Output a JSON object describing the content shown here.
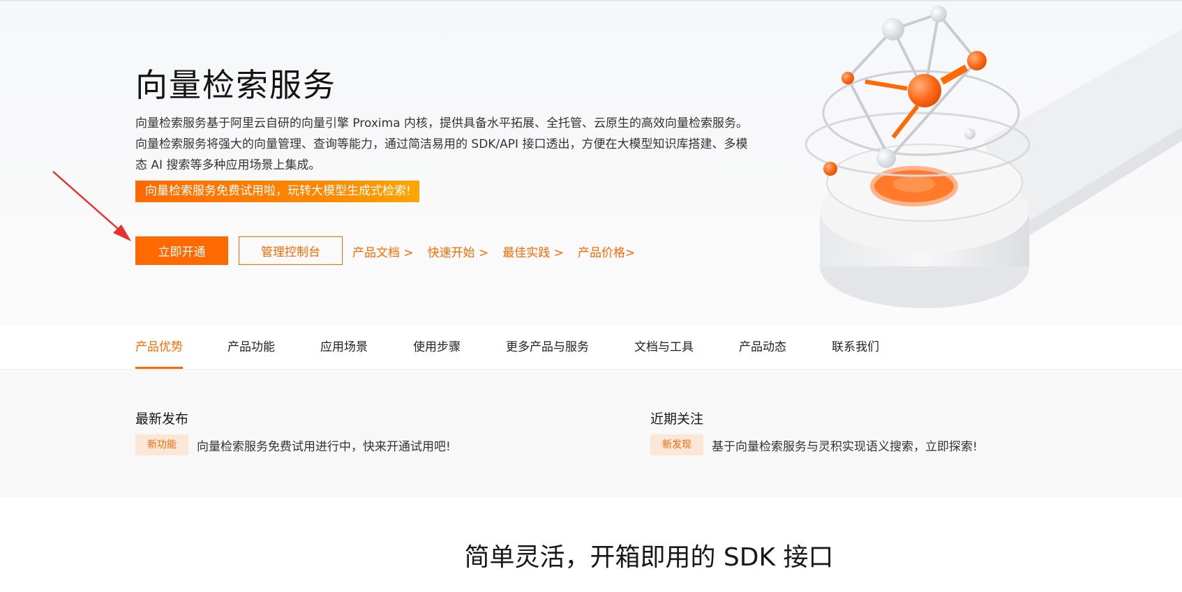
{
  "hero": {
    "title": "向量检索服务",
    "description": "向量检索服务基于阿里云自研的向量引擎 Proxima 内核，提供具备水平拓展、全托管、云原生的高效向量检索服务。向量检索服务将强大的向量管理、查询等能力，通过简洁易用的 SDK/API 接口透出，方便在大模型知识库搭建、多模态 AI 搜索等多种应用场景上集成。",
    "promo": "向量检索服务免费试用啦，玩转大模型生成式检索!",
    "primary_button": "立即开通",
    "secondary_button": "管理控制台",
    "links": [
      "产品文档 >",
      "快速开始 >",
      "最佳实践 >",
      "产品价格>"
    ]
  },
  "tabs": [
    "产品优势",
    "产品功能",
    "应用场景",
    "使用步骤",
    "更多产品与服务",
    "文档与工具",
    "产品动态",
    "联系我们"
  ],
  "news": {
    "left": {
      "heading": "最新发布",
      "tag": "新功能",
      "text": "向量检索服务免费试用进行中，快来开通试用吧!"
    },
    "right": {
      "heading": "近期关注",
      "tag": "新发现",
      "text": "基于向量检索服务与灵积实现语义搜索，立即探索!"
    }
  },
  "section_title": "简单灵活，开箱即用的 SDK 接口",
  "colors": {
    "accent": "#ff6a00",
    "tag_bg": "#fbe6d8",
    "annotation": "#e8312f"
  }
}
